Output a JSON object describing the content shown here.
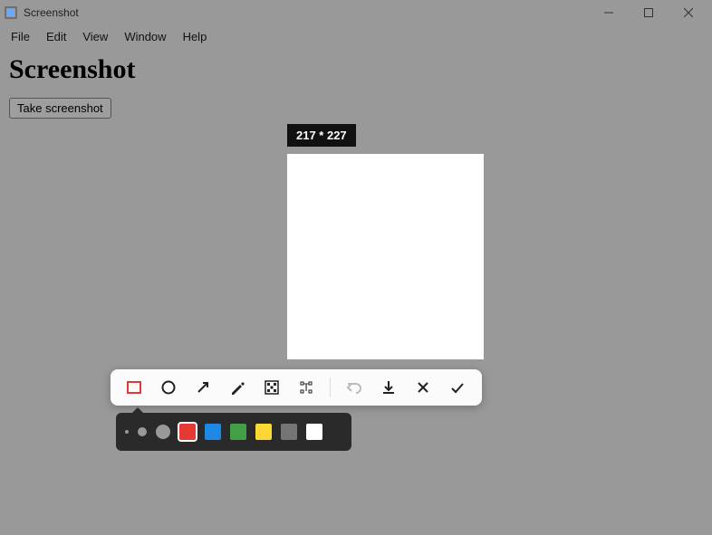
{
  "titlebar": {
    "title": "Screenshot"
  },
  "menubar": {
    "items": [
      "File",
      "Edit",
      "View",
      "Window",
      "Help"
    ]
  },
  "page": {
    "heading": "Screenshot",
    "take_button": "Take screenshot"
  },
  "capture": {
    "size_label": "217 * 227"
  },
  "toolbar": {
    "tools": [
      {
        "name": "rectangle",
        "active": true
      },
      {
        "name": "circle",
        "active": false
      },
      {
        "name": "arrow",
        "active": false
      },
      {
        "name": "pencil",
        "active": false
      },
      {
        "name": "mosaic",
        "active": false
      },
      {
        "name": "text",
        "active": false
      }
    ],
    "actions": [
      {
        "name": "undo"
      },
      {
        "name": "save"
      },
      {
        "name": "cancel"
      },
      {
        "name": "confirm"
      }
    ]
  },
  "subtoolbar": {
    "sizes": [
      "sm",
      "md",
      "lg"
    ],
    "colors": [
      {
        "hex": "#e53935",
        "selected": true
      },
      {
        "hex": "#1e88e5",
        "selected": false
      },
      {
        "hex": "#43a047",
        "selected": false
      },
      {
        "hex": "#fdd835",
        "selected": false
      },
      {
        "hex": "#757575",
        "selected": false
      },
      {
        "hex": "#ffffff",
        "selected": false
      }
    ]
  }
}
